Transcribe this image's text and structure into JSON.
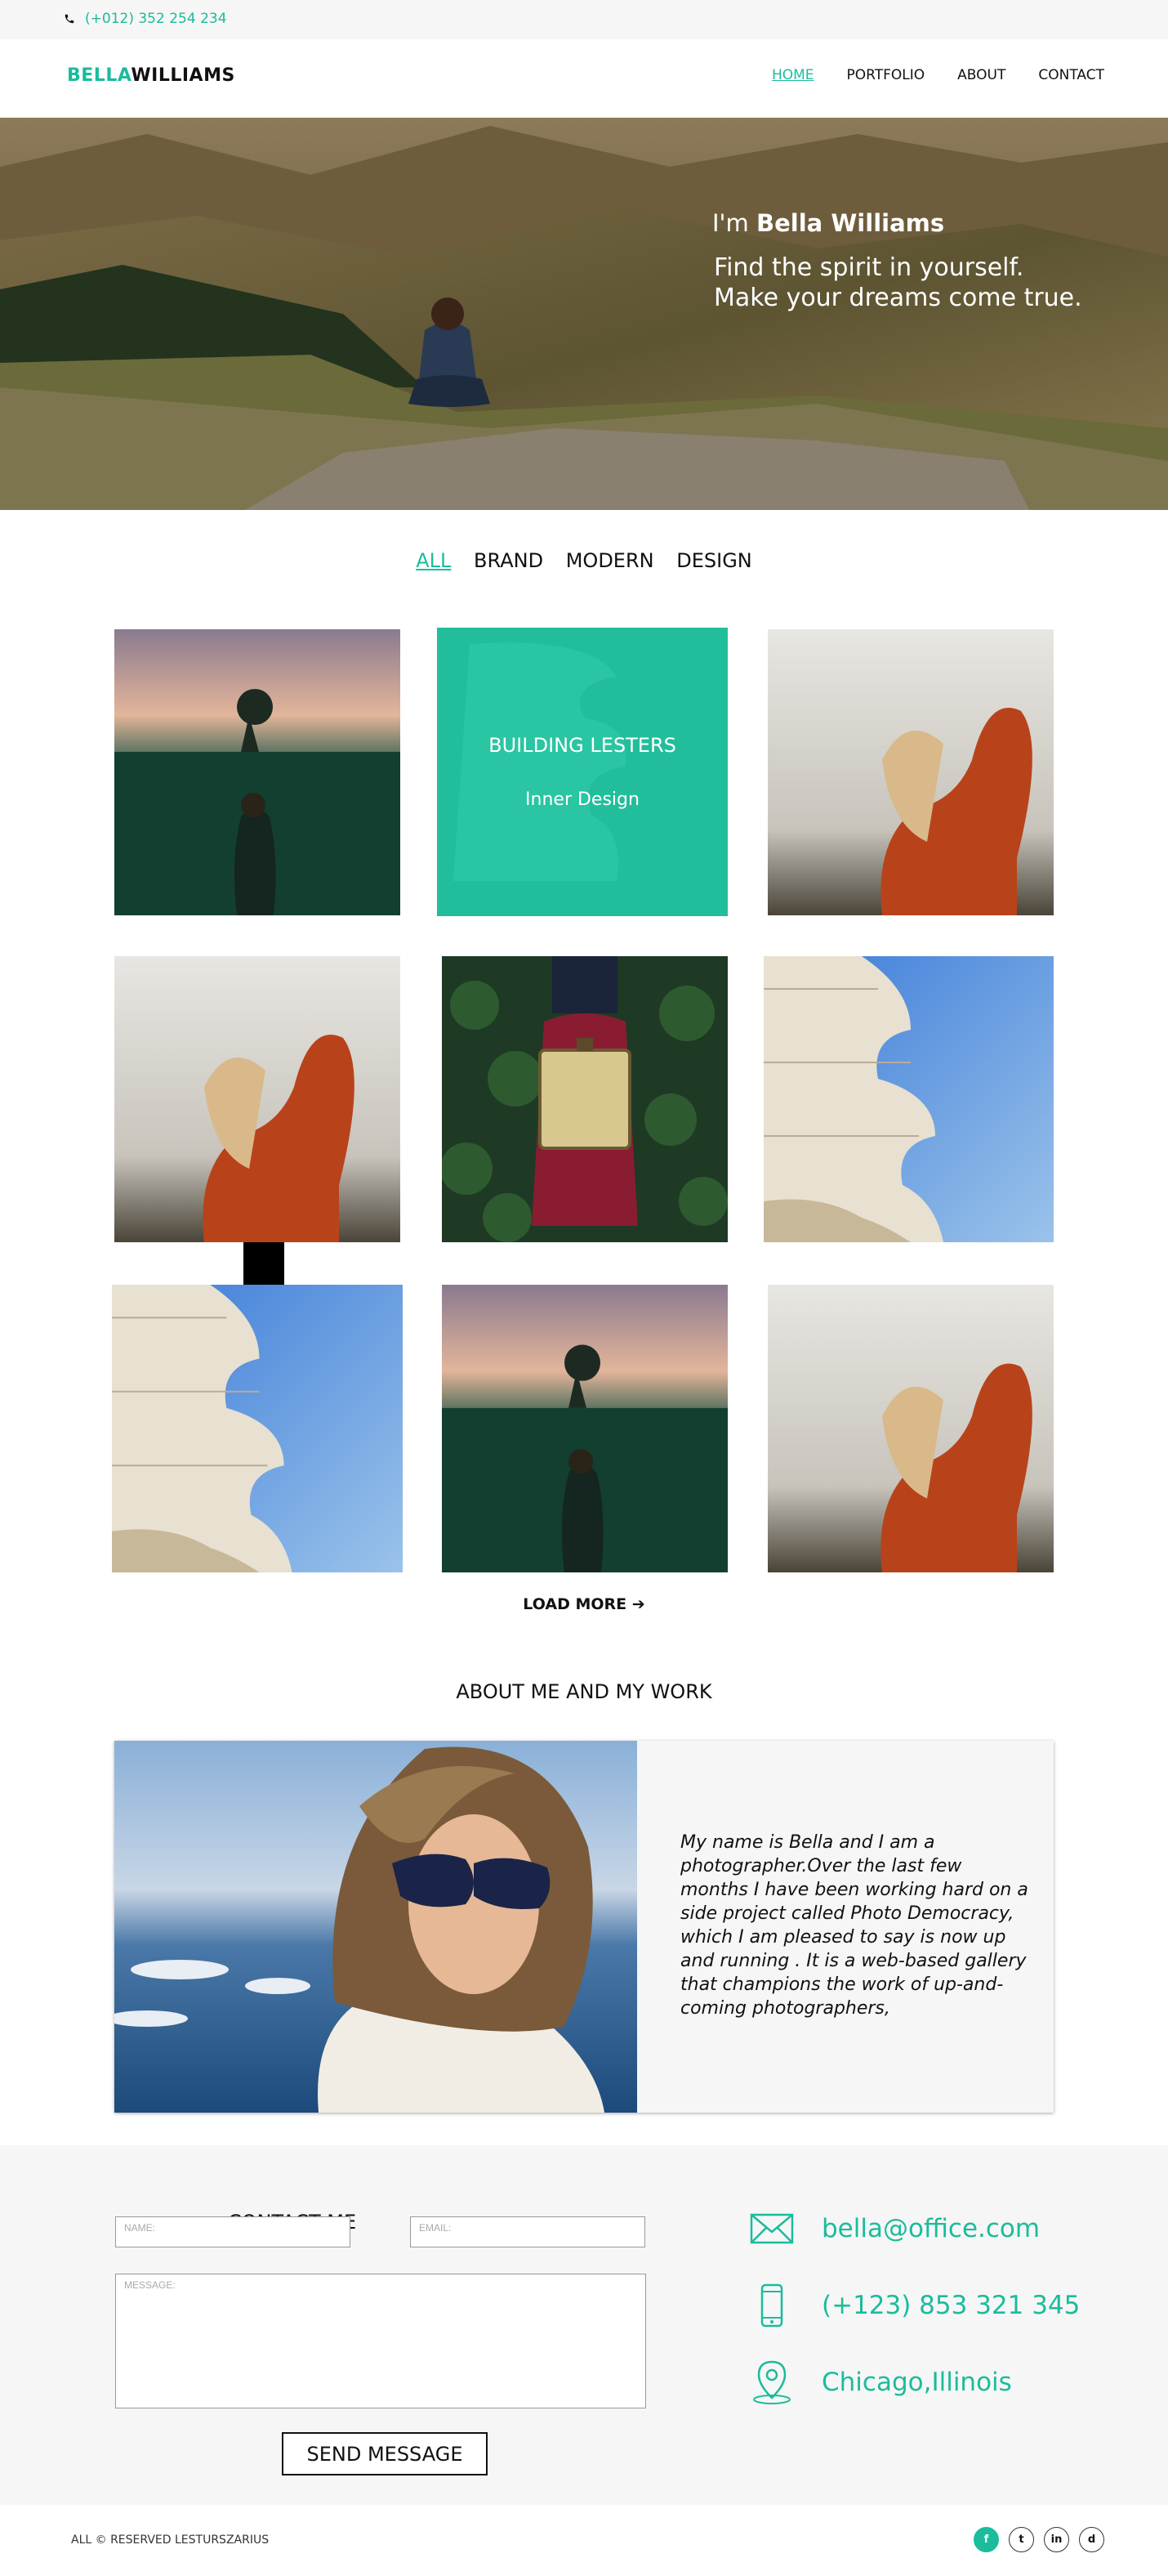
{
  "topbar": {
    "phone": "(+012) 352 254 234",
    "phone_icon": "phone-icon"
  },
  "brand": {
    "first": "BELLA",
    "last": "WILLIAMS"
  },
  "nav": [
    {
      "label": "HOME",
      "active": true
    },
    {
      "label": "PORTFOLIO",
      "active": false
    },
    {
      "label": "ABOUT",
      "active": false
    },
    {
      "label": "CONTACT",
      "active": false
    }
  ],
  "hero": {
    "intro_prefix": "I'm",
    "name": "Bella Williams",
    "tagline_line1": "Find the spirit  in yourself.",
    "tagline_line2": "Make your dreams come true."
  },
  "filters": [
    {
      "label": "ALL",
      "active": true
    },
    {
      "label": "BRAND",
      "active": false
    },
    {
      "label": "MODERN",
      "active": false
    },
    {
      "label": "DESIGN",
      "active": false
    }
  ],
  "gallery": {
    "overlay": {
      "title": "BUILDING LESTERS",
      "subtitle": "Inner Design"
    },
    "load_more": "LOAD MORE"
  },
  "about": {
    "title": "ABOUT ME AND MY WORK",
    "text": "My name is Bella and I am a photographer.Over the last few months I have been working hard on a side project called Photo Democracy, which I am pleased to say is now up and running . It is a web-based gallery that champions the work of up-and-coming photographers,"
  },
  "contact": {
    "title": "CONTACT ME",
    "name_placeholder": "NAME:",
    "email_placeholder": "EMAIL:",
    "message_placeholder": "MESSAGE:",
    "send_label": "SEND MESSAGE",
    "email": "bella@office.com",
    "phone": "(+123) 853 321 345",
    "location": "Chicago,Illinois"
  },
  "footer": {
    "copyright": "ALL © RESERVED LESTURSZARIUS",
    "social": [
      "f",
      "t",
      "in",
      "d"
    ]
  },
  "colors": {
    "accent": "#1abc9c",
    "background_light": "#f6f6f6",
    "text": "#111111"
  }
}
